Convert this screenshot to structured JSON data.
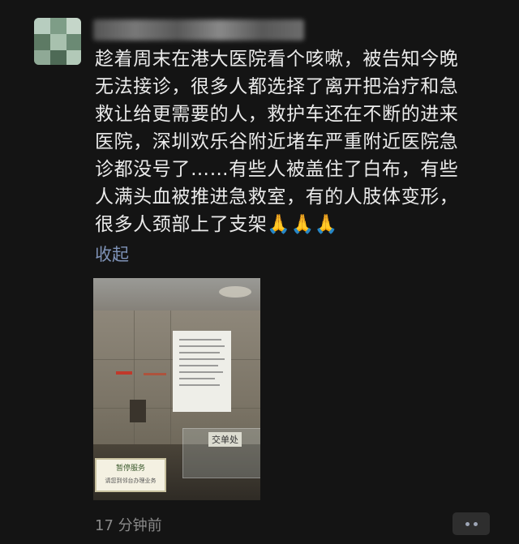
{
  "post": {
    "text": "趁着周末在港大医院看个咳嗽，被告知今晚\n无法接诊，很多人都选择了离开把治疗和急\n救让给更需要的人，救护车还在不断的进来\n医院，深圳欢乐谷附近堵车严重附近医院急\n诊都没号了……有些人被盖住了白布，有些\n人满头血被推进急救室，有的人肢体变形，\n很多人颈部上了支架🙏🙏🙏",
    "collapse_label": "收起",
    "timestamp": "17 分钟前"
  },
  "photo": {
    "counter_sign": "交单处",
    "stop_sign_line1": "暂停服务",
    "stop_sign_line2": "请您到邻台办理业务"
  },
  "colors": {
    "background": "#141414",
    "link": "#7f93b8",
    "timestamp": "#8a8a8a"
  }
}
